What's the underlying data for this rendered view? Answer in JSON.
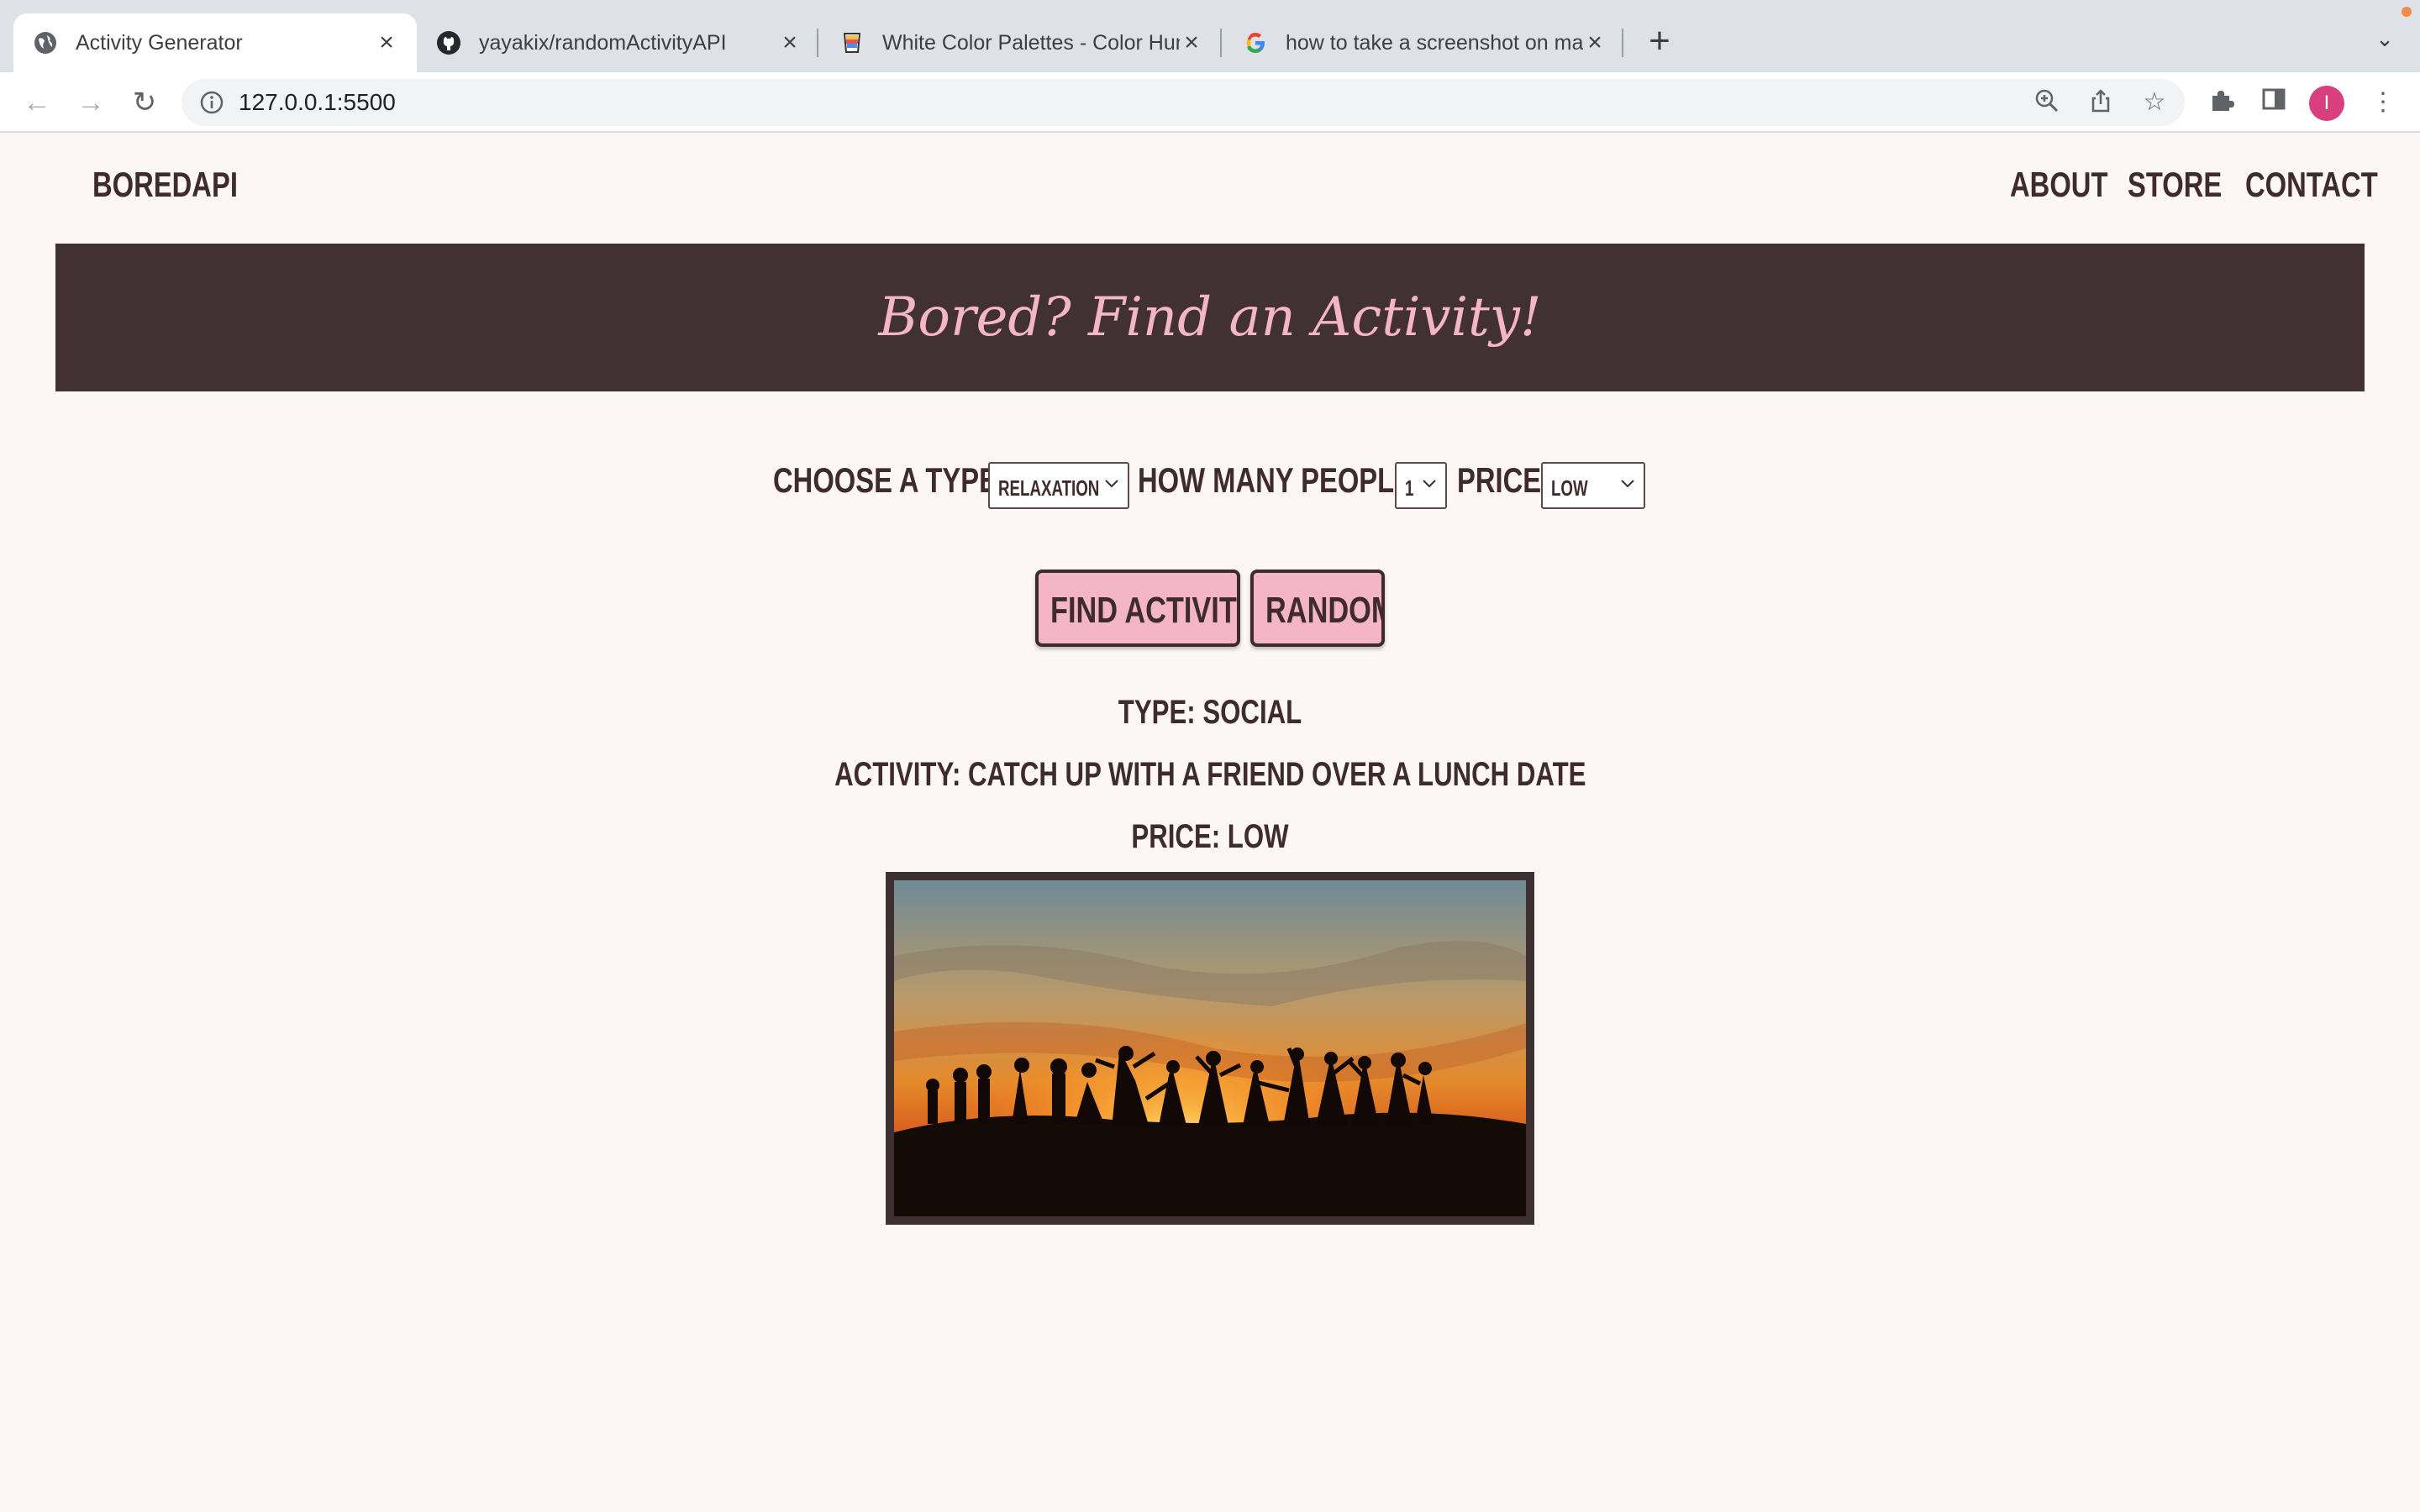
{
  "browser": {
    "tabs": [
      {
        "title": "Activity Generator",
        "icon": "globe-icon",
        "active": true
      },
      {
        "title": "yayakix/randomActivityAPI",
        "icon": "github-icon",
        "active": false
      },
      {
        "title": "White Color Palettes - Color Hunt",
        "icon": "color-hunt-icon",
        "active": false
      },
      {
        "title": "how to take a screenshot on mac",
        "icon": "google-icon",
        "active": false
      }
    ],
    "url": "127.0.0.1:5500",
    "profile_initial": "I"
  },
  "site": {
    "logo": "BOREDAPI",
    "nav": [
      "ABOUT",
      "STORE",
      "CONTACT"
    ],
    "hero_title": "Bored? Find an Activity!"
  },
  "filters": {
    "type_label": "CHOOSE A TYPE:",
    "type_value": "RELAXATION",
    "people_label": "HOW MANY PEOPLE:",
    "people_value": "1",
    "price_label": "PRICE",
    "price_value": "LOW"
  },
  "buttons": {
    "find": "FIND ACTIVITY",
    "random": "RANDOM"
  },
  "result": {
    "type": "TYPE: SOCIAL",
    "activity": "ACTIVITY: CATCH UP WITH A FRIEND OVER A LUNCH DATE",
    "price": "PRICE: LOW"
  },
  "colors": {
    "page_bg": "#fcf7f5",
    "hero_bg": "#413133",
    "accent_pink": "#f4b6c6",
    "text_dark": "#3f2b2d"
  }
}
